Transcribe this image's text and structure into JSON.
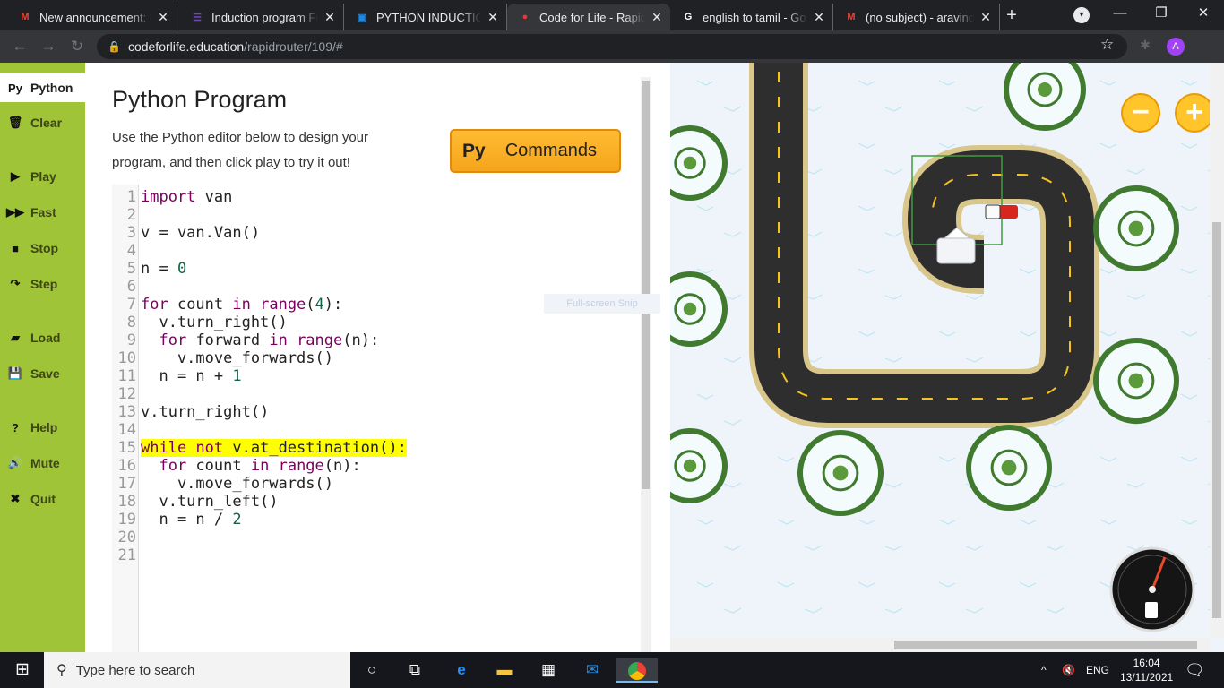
{
  "browser": {
    "tabs": [
      {
        "title": "New announcement: \"",
        "icon": "gmail-icon",
        "icon_color": "#ea4335",
        "icon_text": "M"
      },
      {
        "title": "Induction program Fe",
        "icon": "forms-icon",
        "icon_color": "#7248b9",
        "icon_text": "☰"
      },
      {
        "title": "PYTHON INDUCTION",
        "icon": "classroom-icon",
        "icon_color": "#1e88e5",
        "icon_text": "▣"
      },
      {
        "title": "Code for Life - Rapid R",
        "icon": "codeforlife-icon",
        "icon_color": "#e53935",
        "icon_text": "●",
        "active": true
      },
      {
        "title": "english to tamil - Goo",
        "icon": "google-icon",
        "icon_color": "#ffffff",
        "icon_text": "G"
      },
      {
        "title": "(no subject) - aravind.",
        "icon": "gmail-icon",
        "icon_color": "#ea4335",
        "icon_text": "M"
      }
    ],
    "close_glyph": "✕",
    "new_tab_glyph": "+",
    "url_host": "codeforlife.education",
    "url_path": "/rapidrouter/109/#",
    "profile_initial": "A"
  },
  "sidebar": {
    "python_label": "Python",
    "python_icon_text": "Py",
    "items": [
      {
        "label": "Clear",
        "icon": "trash-icon",
        "glyph": "🗑"
      },
      {
        "label": "Play",
        "icon": "play-icon",
        "glyph": "▶"
      },
      {
        "label": "Fast",
        "icon": "fast-forward-icon",
        "glyph": "▶▶"
      },
      {
        "label": "Stop",
        "icon": "stop-icon",
        "glyph": "■"
      },
      {
        "label": "Step",
        "icon": "step-icon",
        "glyph": "↷"
      },
      {
        "label": "Load",
        "icon": "folder-icon",
        "glyph": "▰"
      },
      {
        "label": "Save",
        "icon": "save-icon",
        "glyph": "💾"
      },
      {
        "label": "Help",
        "icon": "help-icon",
        "glyph": "?"
      },
      {
        "label": "Mute",
        "icon": "speaker-icon",
        "glyph": "🔊"
      },
      {
        "label": "Quit",
        "icon": "close-icon",
        "glyph": "✖"
      }
    ]
  },
  "editor": {
    "title": "Python Program",
    "description": "Use the Python editor below to design your program, and then click play to try it out!",
    "commands_button": {
      "icon_text": "Py",
      "label": "Commands"
    },
    "highlight_line": 15,
    "lines": [
      "import van",
      "",
      "v = van.Van()",
      "",
      "n = 0",
      "",
      "for count in range(4):",
      "  v.turn_right()",
      "  for forward in range(n):",
      "    v.move_forwards()",
      "  n = n + 1",
      "",
      "v.turn_right()",
      "",
      "while not v.at_destination():",
      "  for count in range(n):",
      "    v.move_forwards()",
      "  v.turn_left()",
      "  n = n / 2",
      "",
      ""
    ],
    "snip_overlay": "Full-screen Snip"
  },
  "game": {
    "zoom_out": "−",
    "zoom_in": "+",
    "fuel_gauge_icon": "fuel-gauge-icon",
    "colors": {
      "snow": "#eef4fa",
      "road": "#2e2e2e",
      "kerb": "#d8c68a",
      "lane": "#f7c21c",
      "van": "#d7261e"
    }
  },
  "taskbar": {
    "search_placeholder": "Type here to search",
    "language": "ENG",
    "time": "16:04",
    "date": "13/11/2021"
  }
}
